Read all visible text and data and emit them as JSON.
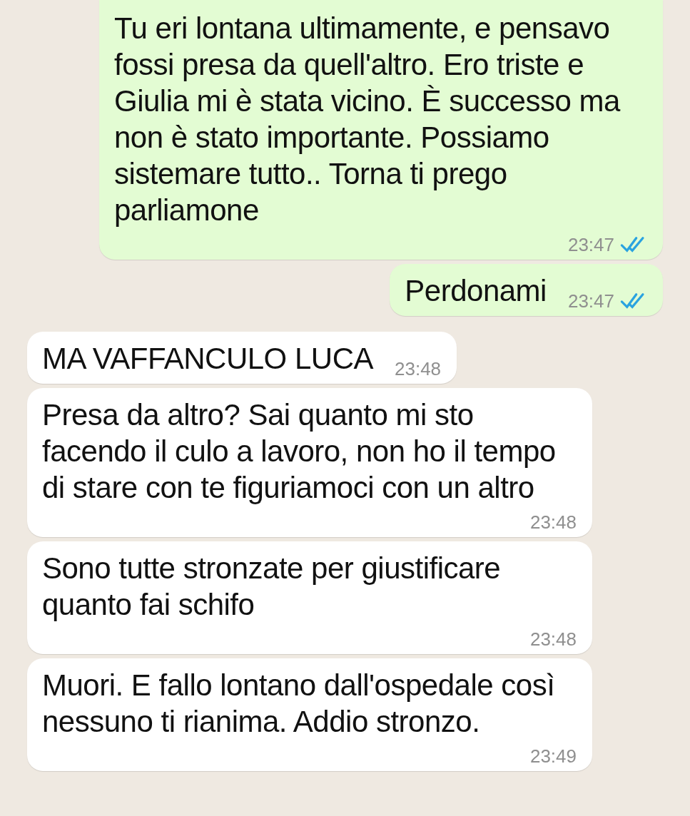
{
  "messages": [
    {
      "kind": "outgoing",
      "text": "Tu eri lontana ultimamente, e pensavo fossi presa da quell'altro. Ero triste e Giulia mi è stata vicino. È successo ma non è stato importante. Possiamo sistemare tutto.. Torna ti prego parliamone",
      "time": "23:47",
      "read": true
    },
    {
      "kind": "outgoing",
      "text": "Perdonami",
      "time": "23:47",
      "read": true
    },
    {
      "kind": "incoming",
      "text": "MA VAFFANCULO LUCA",
      "time": "23:48"
    },
    {
      "kind": "incoming",
      "text": "Presa da altro? Sai quanto mi sto facendo il culo a lavoro, non ho il tempo di stare con te figuriamoci con un altro",
      "time": "23:48"
    },
    {
      "kind": "incoming",
      "text": "Sono tutte stronzate per giustificare quanto fai schifo",
      "time": "23:48"
    },
    {
      "kind": "incoming",
      "text": "Muori. E fallo lontano dall'ospedale così nessuno ti rianima. Addio stronzo.",
      "time": "23:49"
    }
  ]
}
